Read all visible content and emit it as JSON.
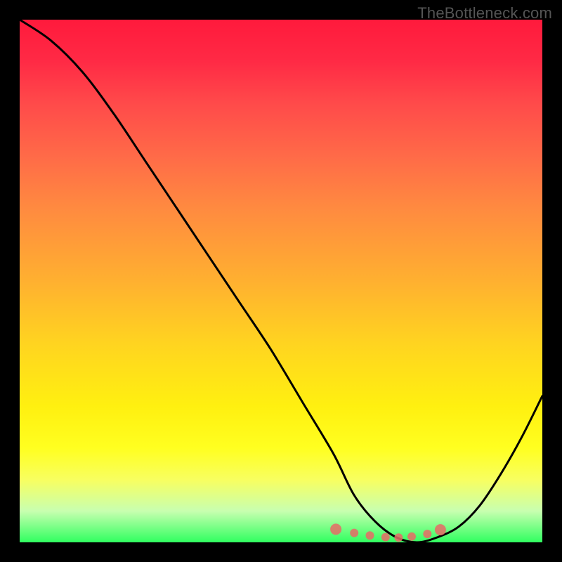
{
  "watermark": "TheBottleneck.com",
  "chart_data": {
    "type": "line",
    "title": "",
    "xlabel": "",
    "ylabel": "",
    "xlim": [
      0,
      100
    ],
    "ylim": [
      0,
      100
    ],
    "series": [
      {
        "name": "bottleneck-curve",
        "x": [
          0,
          6,
          12,
          18,
          24,
          30,
          36,
          42,
          48,
          54,
          60,
          64,
          68,
          72,
          76,
          80,
          84,
          88,
          92,
          96,
          100
        ],
        "y": [
          100,
          96,
          90,
          82,
          73,
          64,
          55,
          46,
          37,
          27,
          17,
          9,
          4,
          1,
          0,
          1,
          3,
          7,
          13,
          20,
          28
        ]
      }
    ],
    "markers": {
      "name": "optimal-range-dots",
      "x": [
        60.5,
        64,
        67,
        70,
        72.5,
        75,
        78,
        80.5
      ],
      "y": [
        2.5,
        1.8,
        1.3,
        1.0,
        0.9,
        1.1,
        1.6,
        2.4
      ]
    }
  }
}
